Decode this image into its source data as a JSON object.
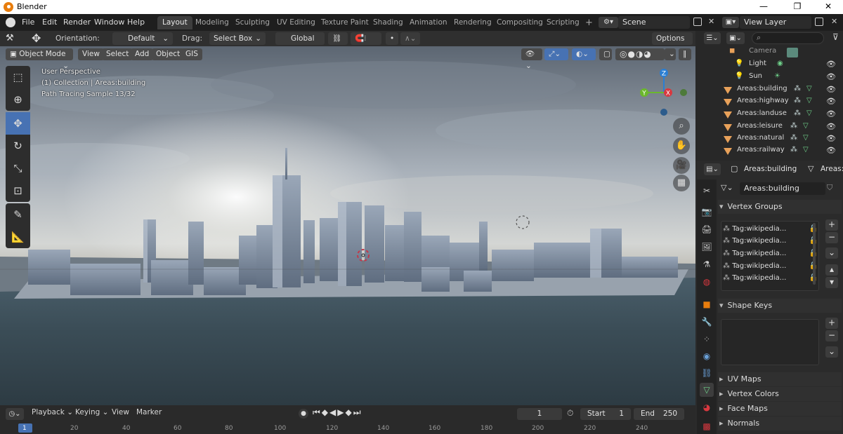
{
  "window": {
    "title": "Blender",
    "min": "—",
    "max": "❐",
    "close": "✕"
  },
  "menu": [
    "File",
    "Edit",
    "Render",
    "Window",
    "Help"
  ],
  "workspaces": [
    "Layout",
    "Modeling",
    "Sculpting",
    "UV Editing",
    "Texture Paint",
    "Shading",
    "Animation",
    "Rendering",
    "Compositing",
    "Scripting"
  ],
  "workspace_add": "+",
  "scene": "Scene",
  "view_layer": "View Layer",
  "toolbar": {
    "orientation_label": "Orientation:",
    "orientation_value": "Default",
    "drag_label": "Drag:",
    "drag_value": "Select Box",
    "transform_space": "Global",
    "options": "Options"
  },
  "viewport_header": {
    "mode": "Object Mode",
    "menus": [
      "View",
      "Select",
      "Add",
      "Object",
      "GIS"
    ]
  },
  "viewport_overlay": {
    "line1": "User Perspective",
    "line2": "(1) Collection | Areas:building",
    "line3": "Path Tracing Sample 13/32"
  },
  "gizmo": {
    "z": "Z",
    "y": "Y",
    "x": "X"
  },
  "outliner": {
    "search_placeholder": "",
    "items": [
      {
        "name": "Camera",
        "type": "camera"
      },
      {
        "name": "Light",
        "type": "light"
      },
      {
        "name": "Sun",
        "type": "light"
      },
      {
        "name": "Areas:building",
        "type": "mesh"
      },
      {
        "name": "Areas:highway",
        "type": "mesh"
      },
      {
        "name": "Areas:landuse",
        "type": "mesh"
      },
      {
        "name": "Areas:leisure",
        "type": "mesh"
      },
      {
        "name": "Areas:natural",
        "type": "mesh"
      },
      {
        "name": "Areas:railway",
        "type": "mesh"
      }
    ]
  },
  "properties": {
    "object_name": "Areas:building",
    "data_name": "Areas:b",
    "mesh_field": "Areas:building",
    "panels": {
      "vertex_groups": "Vertex Groups",
      "shape_keys": "Shape Keys",
      "uv_maps": "UV Maps",
      "vertex_colors": "Vertex Colors",
      "face_maps": "Face Maps",
      "normals": "Normals"
    },
    "vertex_groups": [
      "Tag:wikipedia...",
      "Tag:wikipedia...",
      "Tag:wikipedia...",
      "Tag:wikipedia...",
      "Tag:wikipedia..."
    ]
  },
  "timeline": {
    "menus": [
      "Playback",
      "Keying",
      "View",
      "Marker"
    ],
    "current_frame": "1",
    "start_label": "Start",
    "start": "1",
    "end_label": "End",
    "end": "250",
    "ticks": [
      "1",
      "20",
      "40",
      "60",
      "80",
      "100",
      "120",
      "140",
      "160",
      "180",
      "200",
      "220",
      "240"
    ]
  },
  "colors": {
    "accent": "#4772b3",
    "orange": "#e87d0d",
    "mesh_green": "#6fd18a"
  }
}
